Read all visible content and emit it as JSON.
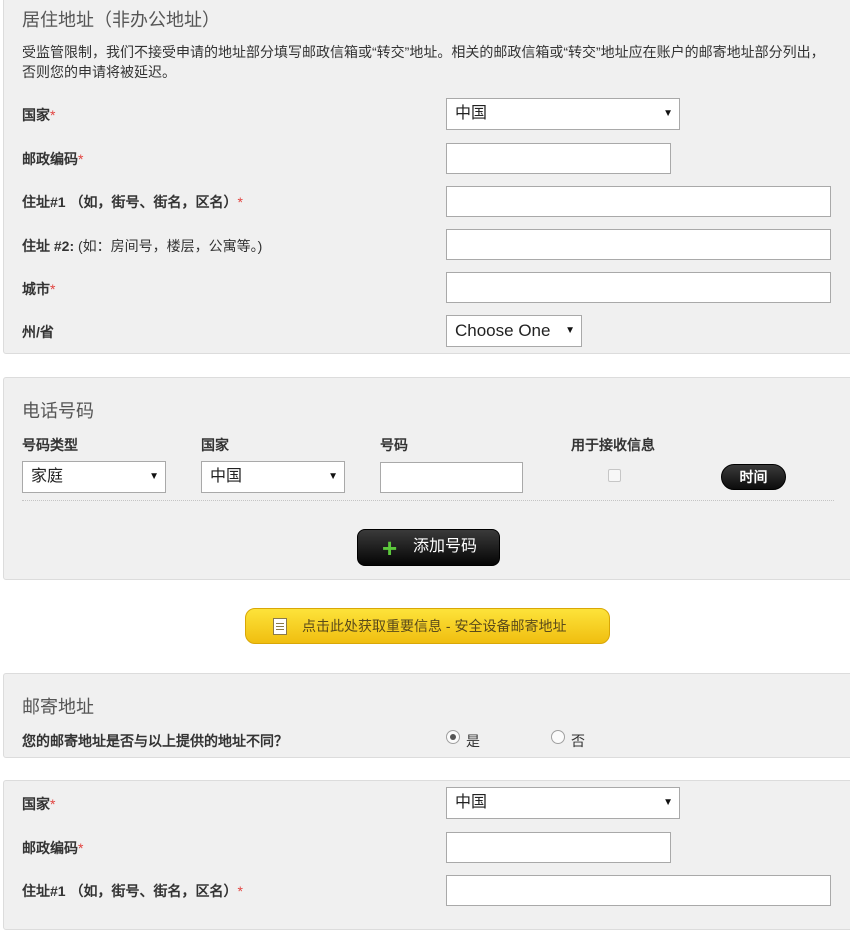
{
  "residence": {
    "title": "居住地址（非办公地址）",
    "description": "受监管限制，我们不接受申请的地址部分填写邮政信箱或“转交”地址。相关的邮政信箱或“转交”地址应在账户的邮寄地址部分列出，否则您的申请将被延迟。",
    "country_label": "国家",
    "country_value": "中国",
    "postal_label": "邮政编码",
    "address1_label": "住址#1 （如，街号、街名，区名）",
    "address2_label": "住址 #2:",
    "address2_note": " (如：房间号，楼层，公寓等。)",
    "city_label": "城市",
    "state_label": "州/省",
    "state_value": "Choose One",
    "required_mark": "*"
  },
  "phone": {
    "title": "电话号码",
    "col_type": "号码类型",
    "col_country": "国家",
    "col_number": "号码",
    "col_sms": "用于接收信息",
    "type_value": "家庭",
    "country_value": "中国",
    "sms_checked": false,
    "time_button": "时间",
    "add_button": "添加号码"
  },
  "important_info": {
    "label": "点击此处获取重要信息 - 安全设备邮寄地址"
  },
  "mailing": {
    "title": "邮寄地址",
    "question": "您的邮寄地址是否与以上提供的地址不同？",
    "yes_label": "是",
    "no_label": "否",
    "selected": "yes"
  },
  "mailing_address": {
    "country_label": "国家",
    "country_value": "中国",
    "postal_label": "邮政编码",
    "address1_label": "住址#1 （如，街号、街名，区名）",
    "required_mark": "*"
  },
  "colors": {
    "required": "#e2433f",
    "panel_bg": "#f0f0f0",
    "yellow_button": "#f7cf20"
  }
}
